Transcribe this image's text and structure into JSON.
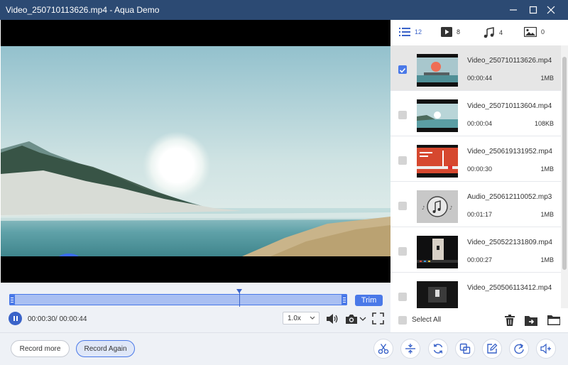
{
  "window": {
    "title": "Video_250710113626.mp4  -  Aqua Demo"
  },
  "controls": {
    "trim_label": "Trim",
    "time_text": "00:00:30/ 00:00:44",
    "speed_value": "1.0x",
    "progress_fraction": 0.68
  },
  "tabs": [
    {
      "icon": "list-icon",
      "count": "12"
    },
    {
      "icon": "video-icon",
      "count": "8"
    },
    {
      "icon": "music-icon",
      "count": "4"
    },
    {
      "icon": "image-icon",
      "count": "0"
    }
  ],
  "files": [
    {
      "name": "Video_250710113626.mp4",
      "duration": "00:00:44",
      "size": "1MB",
      "checked": true
    },
    {
      "name": "Video_250710113604.mp4",
      "duration": "00:00:04",
      "size": "108KB",
      "checked": false
    },
    {
      "name": "Video_250619131952.mp4",
      "duration": "00:00:30",
      "size": "1MB",
      "checked": false
    },
    {
      "name": "Audio_250612110052.mp3",
      "duration": "00:01:17",
      "size": "1MB",
      "checked": false
    },
    {
      "name": "Video_250522131809.mp4",
      "duration": "00:00:27",
      "size": "1MB",
      "checked": false
    },
    {
      "name": "Video_250506113412.mp4",
      "duration": "",
      "size": "",
      "checked": false
    }
  ],
  "footer": {
    "select_all_label": "Select All"
  },
  "bottom": {
    "record_more_label": "Record more",
    "record_again_label": "Record Again"
  },
  "colors": {
    "titlebar": "#2c4a73",
    "accent": "#4a79e8",
    "accent_dark": "#3a63c9"
  }
}
